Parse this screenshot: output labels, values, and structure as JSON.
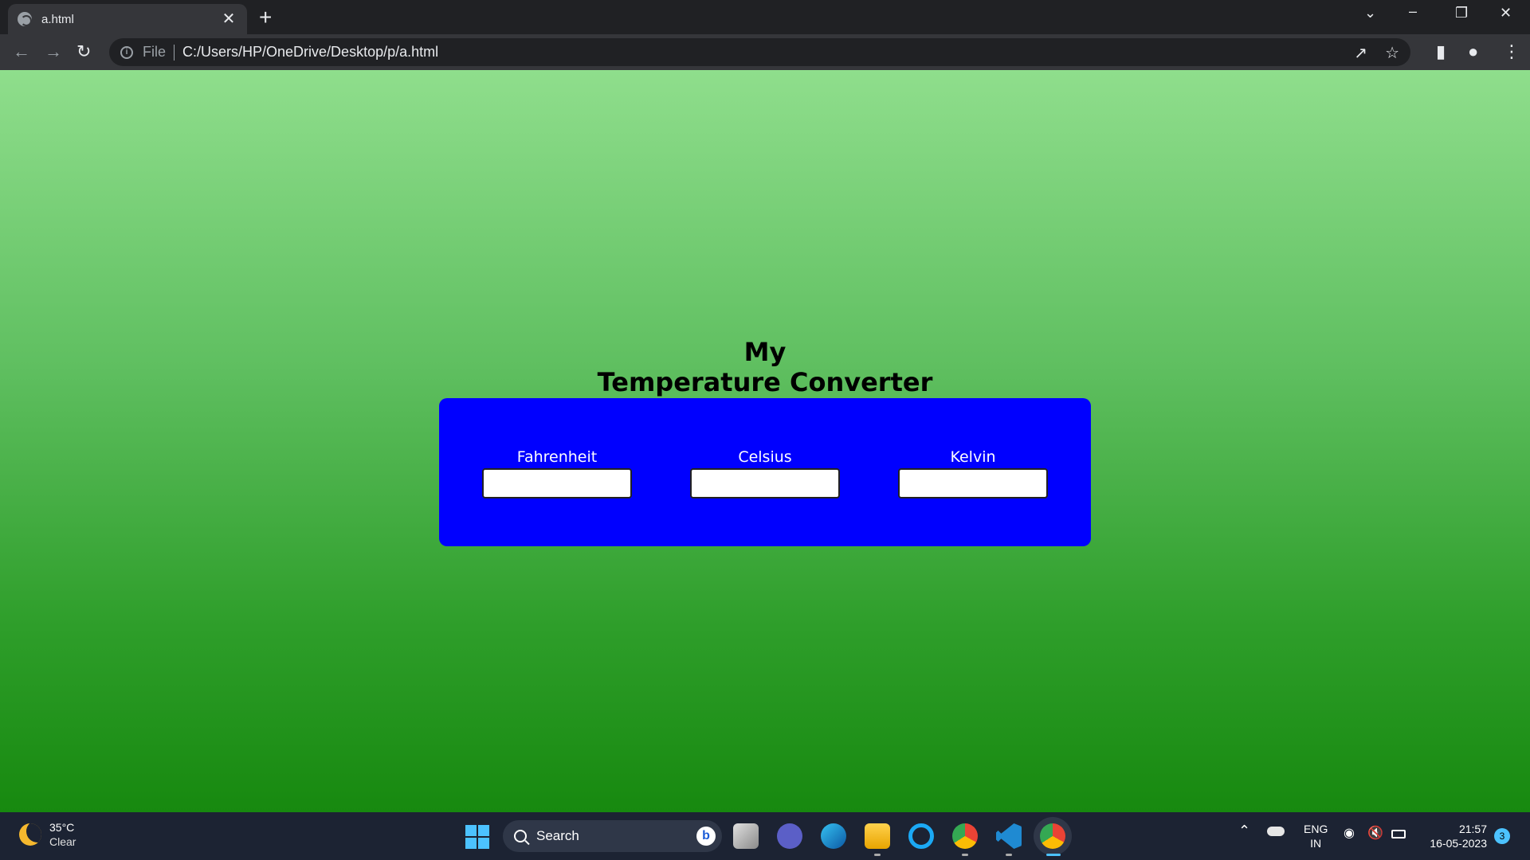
{
  "browser": {
    "tab_title": "a.html",
    "tab_close": "✕",
    "new_tab": "+",
    "address_scheme": "File",
    "address_url": "C:/Users/HP/OneDrive/Desktop/p/a.html"
  },
  "page": {
    "heading_line1": "My",
    "heading_line2": "Temperature Converter",
    "fields": [
      {
        "label": "Fahrenheit",
        "value": ""
      },
      {
        "label": "Celsius",
        "value": ""
      },
      {
        "label": "Kelvin",
        "value": ""
      }
    ],
    "colors": {
      "panel": "#0000ff",
      "background_top": "#8fde8c",
      "background_bottom": "#17890f"
    }
  },
  "taskbar": {
    "weather_temp": "35°C",
    "weather_condition": "Clear",
    "search_placeholder": "Search",
    "bing_letter": "b",
    "lang_line1": "ENG",
    "lang_line2": "IN",
    "time": "21:57",
    "date": "16-05-2023",
    "notification_count": "3"
  }
}
